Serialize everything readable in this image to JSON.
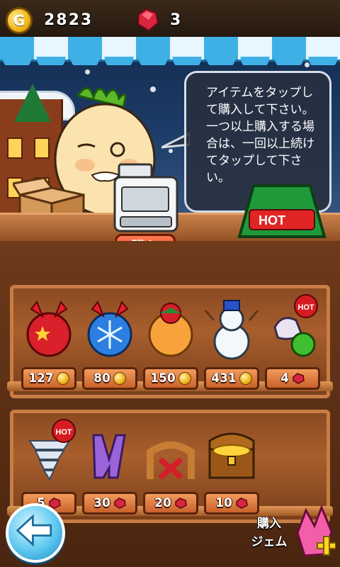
{
  "hud": {
    "coin_symbol": "G",
    "coins": "2823",
    "gems": "3"
  },
  "dialog": {
    "message": "アイテムをタップして購入して下さい。一つ以上購入する場合は、一回以上続けてタップして下さい。"
  },
  "counter": {
    "buy_label": "購入",
    "hot_sign": "HOT"
  },
  "shelves": [
    {
      "items": [
        {
          "name": "red-ornament",
          "price": "127",
          "currency": "coin"
        },
        {
          "name": "blue-snowflake-ornament",
          "price": "80",
          "currency": "coin"
        },
        {
          "name": "poinsettia-orb",
          "price": "150",
          "currency": "coin"
        },
        {
          "name": "snowman",
          "price": "431",
          "currency": "coin"
        },
        {
          "name": "hot-gift-item",
          "price": "4",
          "currency": "gem",
          "badge": "HOT"
        }
      ]
    },
    {
      "items": [
        {
          "name": "tornado",
          "price": "5",
          "currency": "gem",
          "badge": "HOT"
        },
        {
          "name": "purple-magnet",
          "price": "30",
          "currency": "gem"
        },
        {
          "name": "red-bow-arch",
          "price": "20",
          "currency": "gem"
        },
        {
          "name": "treasure-chest",
          "price": "10",
          "currency": "gem"
        }
      ]
    }
  ],
  "footer": {
    "buy_gems_label": "購入\nジェム",
    "buy_gems_line1": "購入",
    "buy_gems_line2": "ジェム"
  },
  "colors": {
    "awning_blue": "#3fb0e6",
    "price_tag": "#e07a3c",
    "gem_red": "#d7263d",
    "coin_gold": "#f1b51a"
  },
  "icons": [
    "coin-icon",
    "gem-icon",
    "back-arrow-icon",
    "cash-register-icon",
    "box-icon"
  ]
}
